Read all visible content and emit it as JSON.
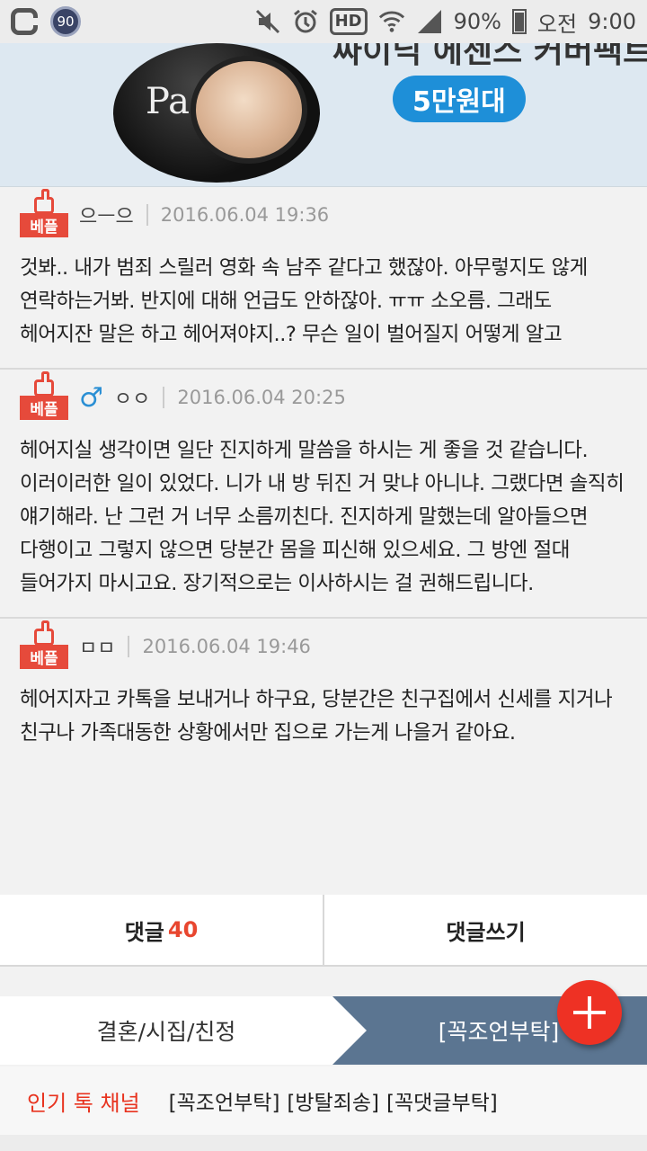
{
  "status_bar": {
    "badge_count": "90",
    "battery": "90%",
    "ampm": "오전",
    "time": "9:00",
    "hd_label": "HD",
    "icons": [
      "app-icon",
      "mute-icon",
      "alarm-icon",
      "hd-icon",
      "wifi-icon",
      "signal-icon",
      "battery-icon"
    ]
  },
  "ad": {
    "headline": "싸이닉 에센스 커버팩트",
    "price": "5만원대",
    "brand": "Pa"
  },
  "comments": [
    {
      "badge": "베플",
      "gender": "",
      "nick": "으ㅡ으",
      "date": "2016.06.04 19:36",
      "body": "것봐.. 내가 범죄 스릴러 영화 속 남주 같다고 했잖아. 아무렇지도 않게 연락하는거봐. 반지에 대해 언급도 안하잖아. ㅠㅠ 소오름. 그래도 헤어지잔 말은 하고 헤어져야지..? 무슨 일이 벌어질지 어떻게 알고"
    },
    {
      "badge": "베플",
      "gender": "♂",
      "nick": "ㅇㅇ",
      "date": "2016.06.04 20:25",
      "body": "헤어지실 생각이면 일단 진지하게 말씀을 하시는 게 좋을 것 같습니다. 이러이러한 일이 있었다. 니가 내 방 뒤진 거 맞냐 아니냐. 그랬다면 솔직히 얘기해라. 난 그런 거 너무 소름끼친다. 진지하게 말했는데 알아들으면 다행이고 그렇지 않으면 당분간 몸을 피신해 있으세요. 그 방엔 절대 들어가지 마시고요. 장기적으로는 이사하시는 걸 권해드립니다."
    },
    {
      "badge": "베플",
      "gender": "",
      "nick": "ㅁㅁ",
      "date": "2016.06.04 19:46",
      "body": "헤어지자고 카톡을 보내거나 하구요, 당분간은 친구집에서 신세를 지거나 친구나 가족대동한 상황에서만 집으로 가는게 나을거 같아요."
    }
  ],
  "comment_buttons": {
    "comments_label": "댓글",
    "comments_count": "40",
    "write_label": "댓글쓰기"
  },
  "category": {
    "left": "결혼/시집/친정",
    "right": "[꼭조언부탁]"
  },
  "popular": {
    "title": "인기 톡 채널",
    "tags": [
      "[꼭조언부탁]",
      "[방탈죄송]",
      "[꼭댓글부탁]"
    ]
  },
  "colors": {
    "accent_red": "#e8462f",
    "badge_red": "#e64a3b",
    "category_blue": "#5b7591",
    "gender_blue": "#2a8fd4"
  }
}
